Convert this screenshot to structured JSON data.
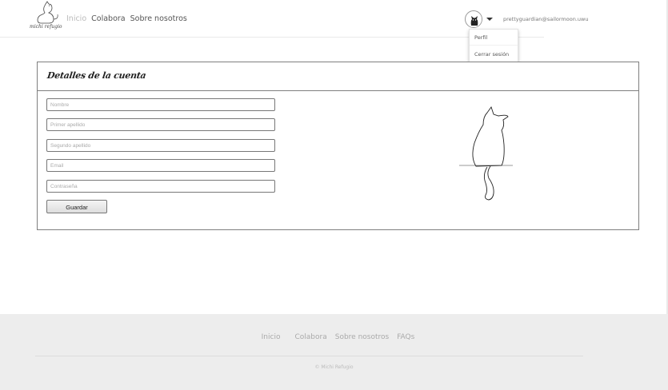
{
  "brand": {
    "logo_text": "michi refugio"
  },
  "nav": {
    "items": [
      {
        "label": "Inicio",
        "active": true
      },
      {
        "label": "Colabora",
        "active": false
      },
      {
        "label": "Sobre nosotros",
        "active": false
      }
    ]
  },
  "user": {
    "email": "prettyguardian@sailormoon.uwu",
    "avatar_icon": "cat-avatar-icon",
    "menu": [
      "Perfil",
      "Cerrar sesión"
    ]
  },
  "account": {
    "title": "Detalles de la cuenta",
    "fields": {
      "nombre": {
        "placeholder": "Nombre",
        "value": ""
      },
      "primer_apellido": {
        "placeholder": "Primer apellido",
        "value": ""
      },
      "segundo_apellido": {
        "placeholder": "Segundo apellido",
        "value": ""
      },
      "email": {
        "placeholder": "Email",
        "value": ""
      },
      "password": {
        "placeholder": "Contraseña",
        "value": ""
      }
    },
    "save_label": "Guardar"
  },
  "footer": {
    "links": [
      "Inicio",
      "Colabora",
      "Sobre nosotros",
      "FAQs"
    ],
    "copyright": "© Michi Refugio"
  },
  "colors": {
    "border": "#7f7f7f",
    "footer_bg": "#ededed",
    "nav_active": "#bbbbbb"
  }
}
